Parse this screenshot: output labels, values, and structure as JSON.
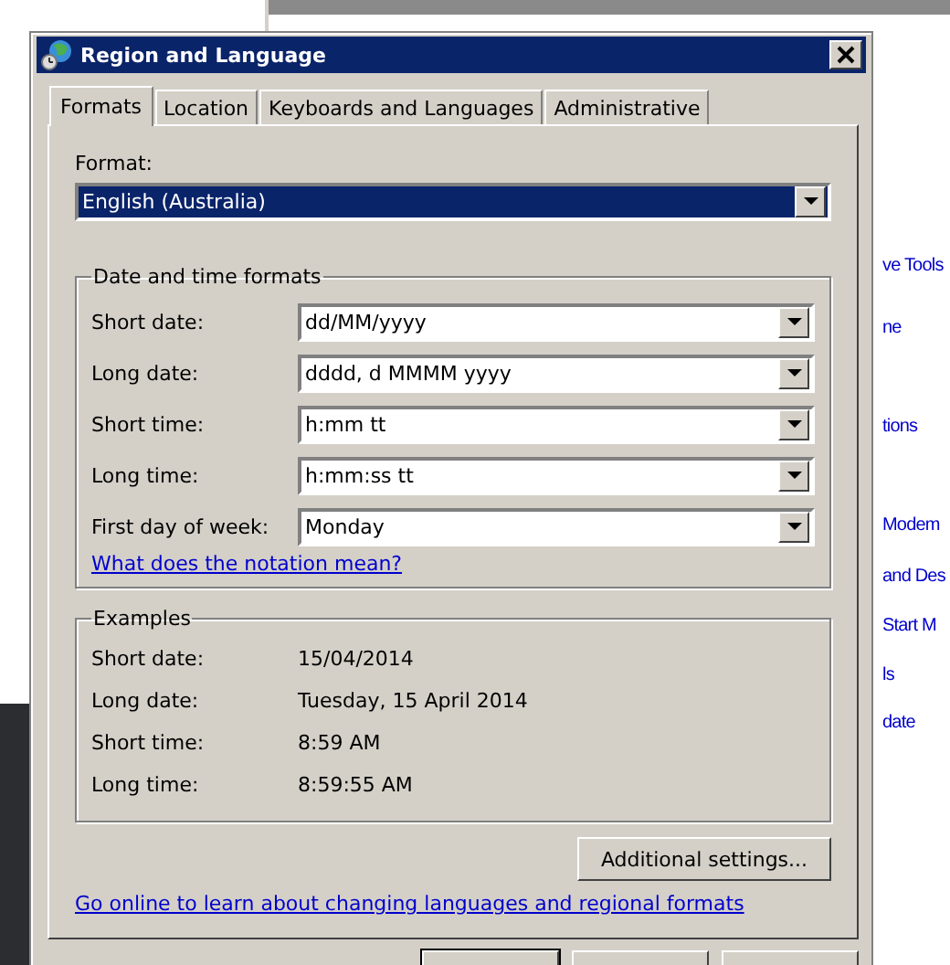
{
  "background_window": {
    "links": [
      "ve Tools",
      "ne",
      "tions",
      "Modem",
      "and Des",
      "Start M",
      "ls",
      "date"
    ]
  },
  "dialog": {
    "title": "Region and Language",
    "tabs": [
      {
        "label": "Formats",
        "selected": true
      },
      {
        "label": "Location",
        "selected": false
      },
      {
        "label": "Keyboards and Languages",
        "selected": false
      },
      {
        "label": "Administrative",
        "selected": false
      }
    ],
    "format_label": "Format:",
    "format_value": "English (Australia)",
    "date_time_group": {
      "title": "Date and time formats",
      "rows": [
        {
          "label": "Short date:",
          "value": "dd/MM/yyyy"
        },
        {
          "label": "Long date:",
          "value": "dddd, d MMMM yyyy"
        },
        {
          "label": "Short time:",
          "value": "h:mm tt"
        },
        {
          "label": "Long time:",
          "value": "h:mm:ss tt"
        },
        {
          "label": "First day of week:",
          "value": "Monday"
        }
      ],
      "link": "What does the notation mean?"
    },
    "examples_group": {
      "title": "Examples",
      "rows": [
        {
          "label": "Short date:",
          "value": "15/04/2014"
        },
        {
          "label": "Long date:",
          "value": "Tuesday, 15 April 2014"
        },
        {
          "label": "Short time:",
          "value": "8:59 AM"
        },
        {
          "label": "Long time:",
          "value": "8:59:55 AM"
        }
      ]
    },
    "additional_button": "Additional settings...",
    "online_link": "Go online to learn about changing languages and regional formats"
  }
}
